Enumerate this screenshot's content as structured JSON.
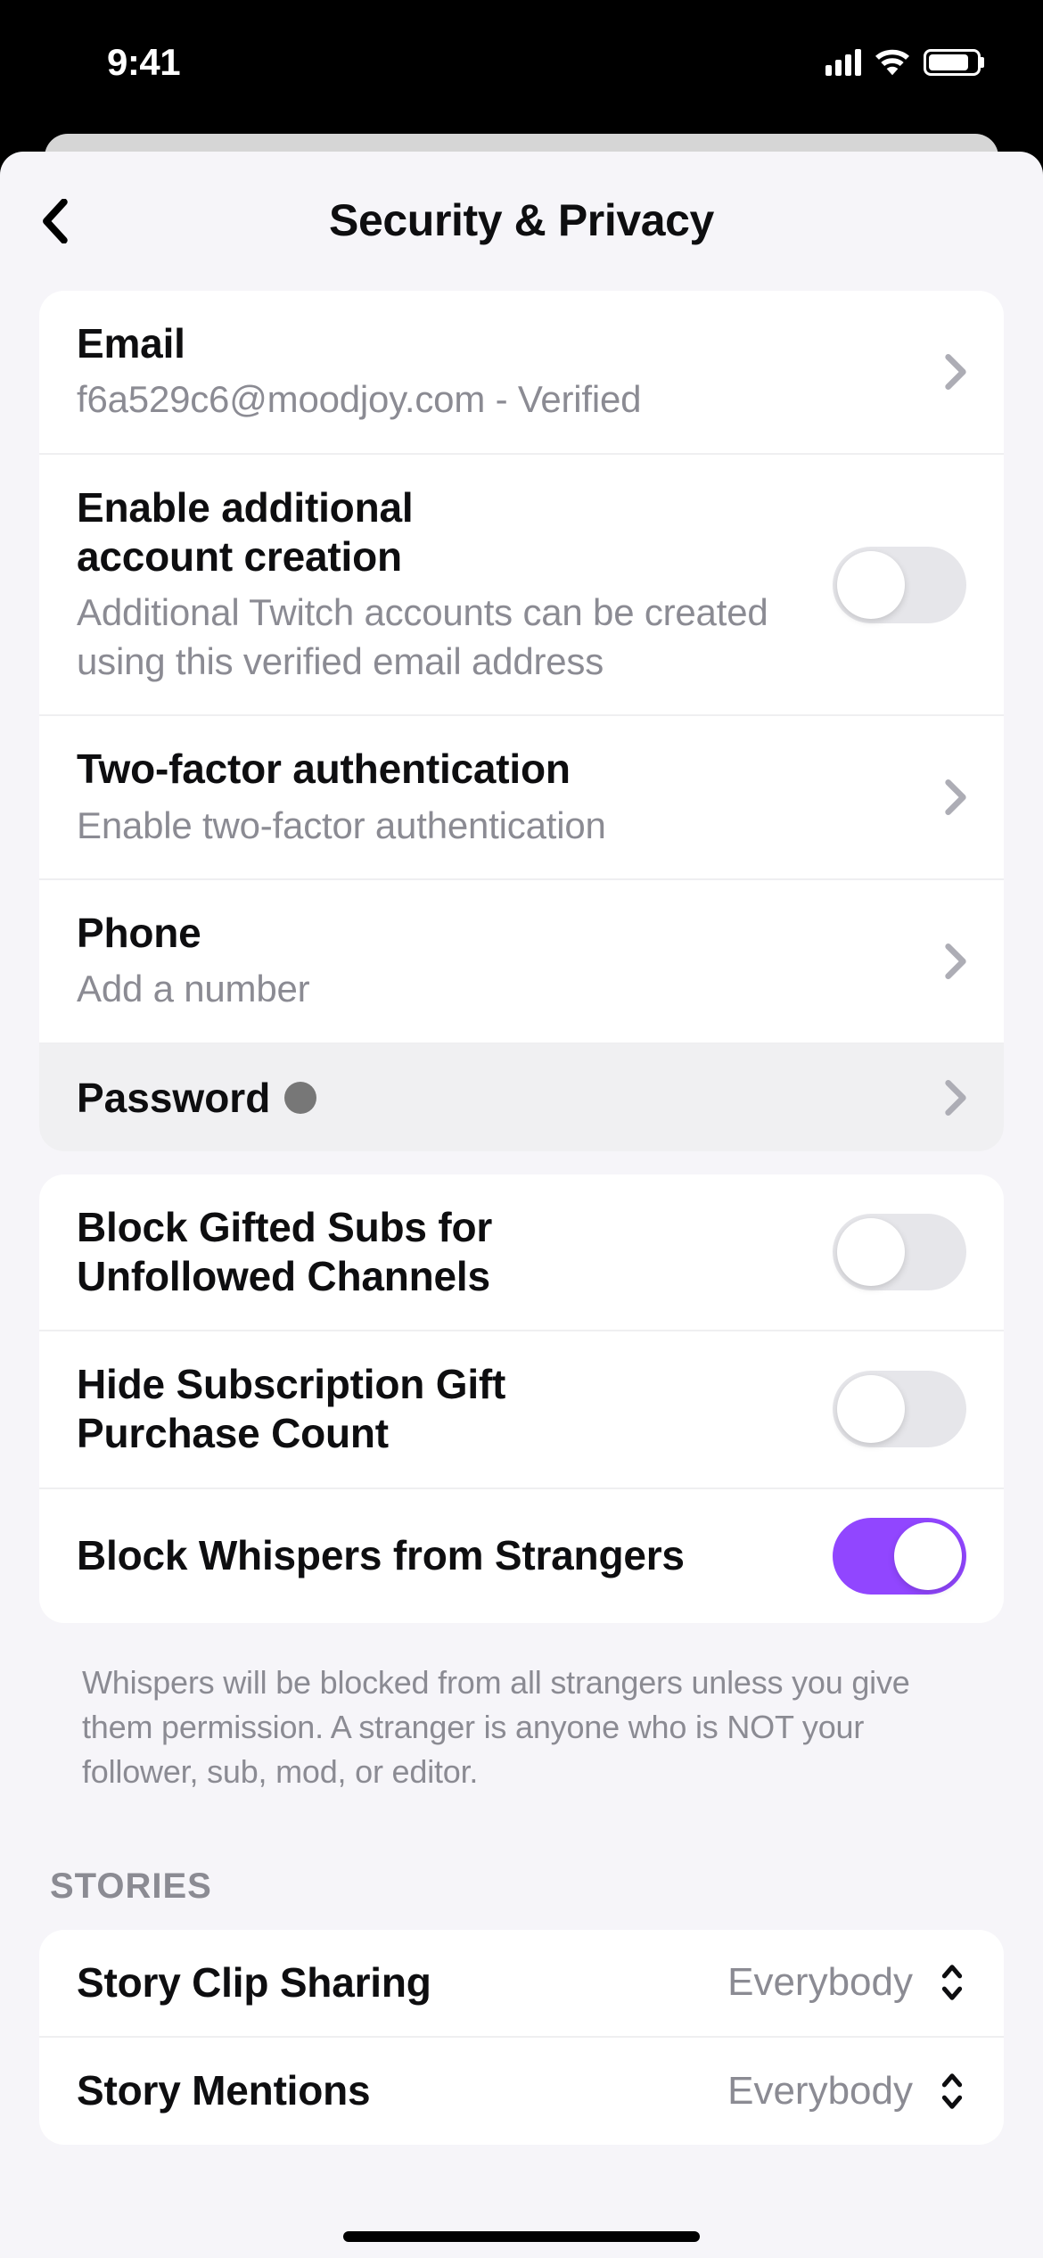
{
  "status": {
    "time": "9:41"
  },
  "header": {
    "title": "Security & Privacy"
  },
  "section1": {
    "email": {
      "title": "Email",
      "value": "f6a529c6@moodjoy.com - Verified"
    },
    "additionalAccount": {
      "title": "Enable additional account creation",
      "subtitle": "Additional Twitch accounts can be created using this verified email address",
      "enabled": false
    },
    "twoFactor": {
      "title": "Two-factor authentication",
      "subtitle": "Enable two-factor authentication"
    },
    "phone": {
      "title": "Phone",
      "subtitle": "Add a number"
    },
    "password": {
      "title": "Password"
    }
  },
  "section2": {
    "blockGiftedSubs": {
      "title": "Block Gifted Subs for Unfollowed Channels",
      "enabled": false
    },
    "hideGiftCount": {
      "title": "Hide Subscription Gift Purchase Count",
      "enabled": false
    },
    "blockWhispers": {
      "title": "Block Whispers from Strangers",
      "enabled": true
    },
    "whispersFooter": "Whispers will be blocked from all strangers unless you give them permission. A stranger is anyone who is NOT your follower, sub, mod, or editor."
  },
  "stories": {
    "header": "STORIES",
    "clipSharing": {
      "title": "Story Clip Sharing",
      "value": "Everybody"
    },
    "mentions": {
      "title": "Story Mentions",
      "value": "Everybody"
    }
  }
}
